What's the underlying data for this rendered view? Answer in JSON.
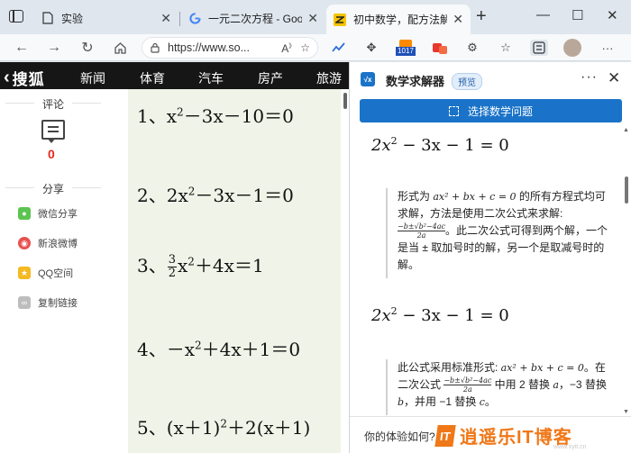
{
  "browser": {
    "tabs": [
      {
        "title": "实验",
        "favicon": "document-icon",
        "active": false
      },
      {
        "title": "一元二次方程 - Google 搜",
        "favicon": "google-icon",
        "active": false
      },
      {
        "title": "初中数学，配方法解一元",
        "favicon": "sohu-icon",
        "active": true
      }
    ],
    "new_tab": "+",
    "window_controls": {
      "minimize": "—",
      "maximize": "☐",
      "close": "✕"
    },
    "url": "https://www.so...",
    "extension_badge": "1017"
  },
  "site": {
    "logo": "搜狐",
    "nav": [
      "新闻",
      "体育",
      "汽车",
      "房产",
      "旅游"
    ],
    "side": {
      "comment_heading": "评论",
      "comment_count": "0",
      "share_heading": "分享",
      "share_items": [
        {
          "label": "微信分享",
          "color": "#5cc451"
        },
        {
          "label": "新浪微博",
          "color": "#e6514f"
        },
        {
          "label": "QQ空间",
          "color": "#f5b922"
        },
        {
          "label": "复制链接",
          "color": "#bdbdbd"
        }
      ]
    },
    "equations": [
      {
        "num": "1、",
        "a": "x",
        "b": "－3x－10＝0"
      },
      {
        "num": "2、",
        "a": "2x",
        "b": "－3x－1＝0"
      },
      {
        "num": "3、",
        "frac_num": "3",
        "frac_den": "2",
        "a": "x",
        "b": "＋4x＝1"
      },
      {
        "num": "4、",
        "a": "－x",
        "b": "＋4x＋1＝0"
      },
      {
        "num": "5、",
        "a": "(x＋1)",
        "b": "＋2(x＋1)"
      }
    ],
    "sup": "2"
  },
  "panel": {
    "title": "数学求解器",
    "badge": "预览",
    "select_button": "选择数学问题",
    "equation": "2x",
    "equation_rest": "− 3x − 1 = 0",
    "sup": "2",
    "explain1_parts": [
      "形式为 ",
      "ax² + bx + c = 0",
      " 的所有方程式均可求解，方法是使用二次公式来求解: ",
      "。此二次公式可得到两个解，一个是当 ± 取加号时的解，另一个是取减号时的解。"
    ],
    "formula_num": "−b±√b²−4ac",
    "formula_den": "2a",
    "explain2_parts": [
      "此公式采用标准形式: ",
      "ax² + bx + c = 0",
      "。在二次公式 ",
      " 中用 2 替换 ",
      "a",
      "，−3 替换 ",
      "b",
      "，并用 −1 替换 ",
      "c",
      "。"
    ],
    "feedback": "你的体验如何?",
    "watermark": "逍遥乐IT博客",
    "watermark_logo": "IT",
    "watermark_sub": "www.xyit.cn"
  }
}
